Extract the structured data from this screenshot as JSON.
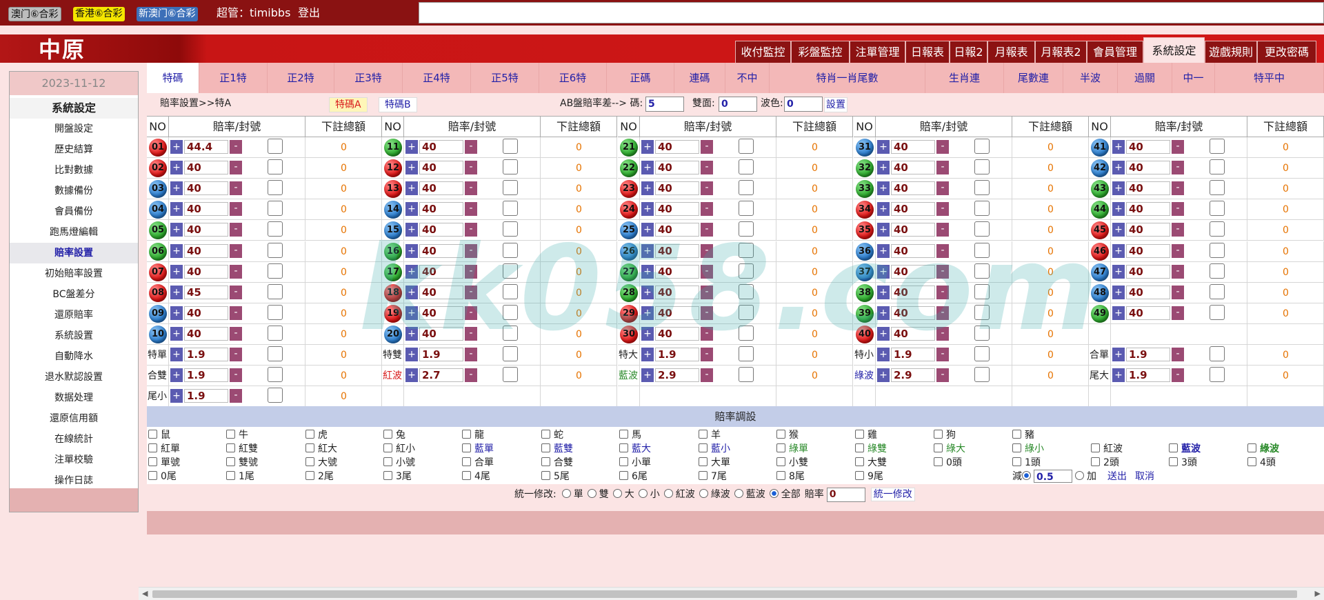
{
  "topbar": {
    "lotteries": [
      "澳门⑥合彩",
      "香港⑥合彩",
      "新澳门⑥合彩"
    ],
    "user": "超管：timibbs",
    "logout": "登出"
  },
  "header": {
    "logo": "中原",
    "nav": [
      "收付監控",
      "彩盤監控",
      "注單管理",
      "日報表",
      "日報2",
      "月報表",
      "月報表2",
      "會員管理",
      "系統設定",
      "遊戲規則",
      "更改密碼"
    ],
    "active_nav": "系統設定"
  },
  "sidebar": {
    "date": "2023-11-12",
    "title": "系統設定",
    "items": [
      "開盤設定",
      "歷史結算",
      "比對數據",
      "數據備份",
      "會員備份",
      "跑馬燈編輯",
      "賠率設置",
      "初始賠率設置",
      "BC盤差分",
      "還原賠率",
      "系統設置",
      "自動降水",
      "退水默認設置",
      "数据处理",
      "還原信用額",
      "在線統計",
      "注單校驗",
      "操作日誌"
    ],
    "active": "賠率設置"
  },
  "subtabs": [
    "特碼",
    "正1特",
    "正2特",
    "正3特",
    "正4特",
    "正5特",
    "正6特",
    "正碼",
    "連碼",
    "不中",
    "特肖一肖尾數",
    "生肖連",
    "尾數連",
    "半波",
    "過關",
    "中一",
    "特平中"
  ],
  "info": {
    "breadcrumb": "賠率設置>>特A",
    "btnA": "特碼A",
    "btnB": "特碼B",
    "ab_label": "AB盤賠率差--> 碼:",
    "ab_value": "5",
    "shuangmian_label": "雙面:",
    "shuangmian_value": "0",
    "bose_label": "波色:",
    "bose_value": "0",
    "set": "設置"
  },
  "grid": {
    "headers": [
      "NO",
      "賠率/封號",
      "下註總額"
    ],
    "numbers": [
      {
        "n": "01",
        "c": "red",
        "o": "44.4"
      },
      {
        "n": "02",
        "c": "red",
        "o": "40"
      },
      {
        "n": "03",
        "c": "blue",
        "o": "40"
      },
      {
        "n": "04",
        "c": "blue",
        "o": "40"
      },
      {
        "n": "05",
        "c": "green",
        "o": "40"
      },
      {
        "n": "06",
        "c": "green",
        "o": "40"
      },
      {
        "n": "07",
        "c": "red",
        "o": "40"
      },
      {
        "n": "08",
        "c": "red",
        "o": "45"
      },
      {
        "n": "09",
        "c": "blue",
        "o": "40"
      },
      {
        "n": "10",
        "c": "blue",
        "o": "40"
      },
      {
        "n": "11",
        "c": "green",
        "o": "40"
      },
      {
        "n": "12",
        "c": "red",
        "o": "40"
      },
      {
        "n": "13",
        "c": "red",
        "o": "40"
      },
      {
        "n": "14",
        "c": "blue",
        "o": "40"
      },
      {
        "n": "15",
        "c": "blue",
        "o": "40"
      },
      {
        "n": "16",
        "c": "green",
        "o": "40"
      },
      {
        "n": "17",
        "c": "green",
        "o": "40"
      },
      {
        "n": "18",
        "c": "red",
        "o": "40"
      },
      {
        "n": "19",
        "c": "red",
        "o": "40"
      },
      {
        "n": "20",
        "c": "blue",
        "o": "40"
      },
      {
        "n": "21",
        "c": "green",
        "o": "40"
      },
      {
        "n": "22",
        "c": "green",
        "o": "40"
      },
      {
        "n": "23",
        "c": "red",
        "o": "40"
      },
      {
        "n": "24",
        "c": "red",
        "o": "40"
      },
      {
        "n": "25",
        "c": "blue",
        "o": "40"
      },
      {
        "n": "26",
        "c": "blue",
        "o": "40"
      },
      {
        "n": "27",
        "c": "green",
        "o": "40"
      },
      {
        "n": "28",
        "c": "green",
        "o": "40"
      },
      {
        "n": "29",
        "c": "red",
        "o": "40"
      },
      {
        "n": "30",
        "c": "red",
        "o": "40"
      },
      {
        "n": "31",
        "c": "blue",
        "o": "40"
      },
      {
        "n": "32",
        "c": "green",
        "o": "40"
      },
      {
        "n": "33",
        "c": "green",
        "o": "40"
      },
      {
        "n": "34",
        "c": "red",
        "o": "40"
      },
      {
        "n": "35",
        "c": "red",
        "o": "40"
      },
      {
        "n": "36",
        "c": "blue",
        "o": "40"
      },
      {
        "n": "37",
        "c": "blue",
        "o": "40"
      },
      {
        "n": "38",
        "c": "green",
        "o": "40"
      },
      {
        "n": "39",
        "c": "green",
        "o": "40"
      },
      {
        "n": "40",
        "c": "red",
        "o": "40"
      },
      {
        "n": "41",
        "c": "blue",
        "o": "40"
      },
      {
        "n": "42",
        "c": "blue",
        "o": "40"
      },
      {
        "n": "43",
        "c": "green",
        "o": "40"
      },
      {
        "n": "44",
        "c": "green",
        "o": "40"
      },
      {
        "n": "45",
        "c": "red",
        "o": "40"
      },
      {
        "n": "46",
        "c": "red",
        "o": "40"
      },
      {
        "n": "47",
        "c": "blue",
        "o": "40"
      },
      {
        "n": "48",
        "c": "blue",
        "o": "40"
      },
      {
        "n": "49",
        "c": "green",
        "o": "40"
      }
    ],
    "special": [
      {
        "label": "特單",
        "o": "1.9",
        "col": 0,
        "row": 10,
        "color": "#222"
      },
      {
        "label": "合雙",
        "o": "1.9",
        "col": 0,
        "row": 11,
        "color": "#222"
      },
      {
        "label": "尾小",
        "o": "1.9",
        "col": 0,
        "row": 12,
        "color": "#222"
      },
      {
        "label": "特雙",
        "o": "1.9",
        "col": 1,
        "row": 10,
        "color": "#222"
      },
      {
        "label": "紅波",
        "o": "2.7",
        "col": 1,
        "row": 11,
        "color": "#d81b1b"
      },
      {
        "label": "特大",
        "o": "1.9",
        "col": 2,
        "row": 10,
        "color": "#222"
      },
      {
        "label": "藍波",
        "o": "2.9",
        "col": 2,
        "row": 11,
        "color": "#2a8a2a"
      },
      {
        "label": "特小",
        "o": "1.9",
        "col": 3,
        "row": 10,
        "color": "#222"
      },
      {
        "label": "綠波",
        "o": "2.9",
        "col": 3,
        "row": 11,
        "color": "#2321a8"
      },
      {
        "label": "合單",
        "o": "1.9",
        "col": 4,
        "row": 10,
        "color": "#222"
      },
      {
        "label": "尾大",
        "o": "1.9",
        "col": 4,
        "row": 11,
        "color": "#222"
      }
    ],
    "total": "0"
  },
  "adjust": {
    "title": "賠率調設",
    "rows": [
      [
        {
          "t": "鼠",
          "c": "#222"
        },
        {
          "t": "牛",
          "c": "#222"
        },
        {
          "t": "虎",
          "c": "#222"
        },
        {
          "t": "兔",
          "c": "#222"
        },
        {
          "t": "龍",
          "c": "#222"
        },
        {
          "t": "蛇",
          "c": "#222"
        },
        {
          "t": "馬",
          "c": "#222"
        },
        {
          "t": "羊",
          "c": "#222"
        },
        {
          "t": "猴",
          "c": "#222"
        },
        {
          "t": "雞",
          "c": "#222"
        },
        {
          "t": "狗",
          "c": "#222"
        },
        {
          "t": "豬",
          "c": "#222"
        }
      ],
      [
        {
          "t": "紅單",
          "c": "#222"
        },
        {
          "t": "紅雙",
          "c": "#222"
        },
        {
          "t": "紅大",
          "c": "#222"
        },
        {
          "t": "紅小",
          "c": "#222"
        },
        {
          "t": "藍單",
          "c": "#2321a8"
        },
        {
          "t": "藍雙",
          "c": "#2321a8"
        },
        {
          "t": "藍大",
          "c": "#2321a8"
        },
        {
          "t": "藍小",
          "c": "#2321a8"
        },
        {
          "t": "綠單",
          "c": "#2a8a2a"
        },
        {
          "t": "綠雙",
          "c": "#2a8a2a"
        },
        {
          "t": "綠大",
          "c": "#2a8a2a"
        },
        {
          "t": "綠小",
          "c": "#2a8a2a"
        },
        {
          "t": "紅波",
          "c": "#222"
        },
        {
          "t": "藍波",
          "c": "#2321a8"
        },
        {
          "t": "綠波",
          "c": "#2a8a2a"
        }
      ],
      [
        {
          "t": "單號",
          "c": "#222"
        },
        {
          "t": "雙號",
          "c": "#222"
        },
        {
          "t": "大號",
          "c": "#222"
        },
        {
          "t": "小號",
          "c": "#222"
        },
        {
          "t": "合單",
          "c": "#222"
        },
        {
          "t": "合雙",
          "c": "#222"
        },
        {
          "t": "小單",
          "c": "#222"
        },
        {
          "t": "大單",
          "c": "#222"
        },
        {
          "t": "小雙",
          "c": "#222"
        },
        {
          "t": "大雙",
          "c": "#222"
        },
        {
          "t": "0頭",
          "c": "#222"
        },
        {
          "t": "1頭",
          "c": "#222"
        },
        {
          "t": "2頭",
          "c": "#222"
        },
        {
          "t": "3頭",
          "c": "#222"
        },
        {
          "t": "4頭",
          "c": "#222"
        }
      ],
      [
        {
          "t": "0尾",
          "c": "#222"
        },
        {
          "t": "1尾",
          "c": "#222"
        },
        {
          "t": "2尾",
          "c": "#222"
        },
        {
          "t": "3尾",
          "c": "#222"
        },
        {
          "t": "4尾",
          "c": "#222"
        },
        {
          "t": "5尾",
          "c": "#222"
        },
        {
          "t": "6尾",
          "c": "#222"
        },
        {
          "t": "7尾",
          "c": "#222"
        },
        {
          "t": "8尾",
          "c": "#222"
        },
        {
          "t": "9尾",
          "c": "#222"
        }
      ]
    ],
    "decrease": "減",
    "amount": "0.5",
    "increase": "加",
    "submit": "送出",
    "cancel": "取消"
  },
  "unify": {
    "label": "統一修改:",
    "options": [
      "單",
      "雙",
      "大",
      "小",
      "紅波",
      "綠波",
      "藍波",
      "全部"
    ],
    "selected": "全部",
    "odds_label": "賠率",
    "odds_value": "0",
    "button": "統一修改"
  },
  "watermark": "kk058.com"
}
